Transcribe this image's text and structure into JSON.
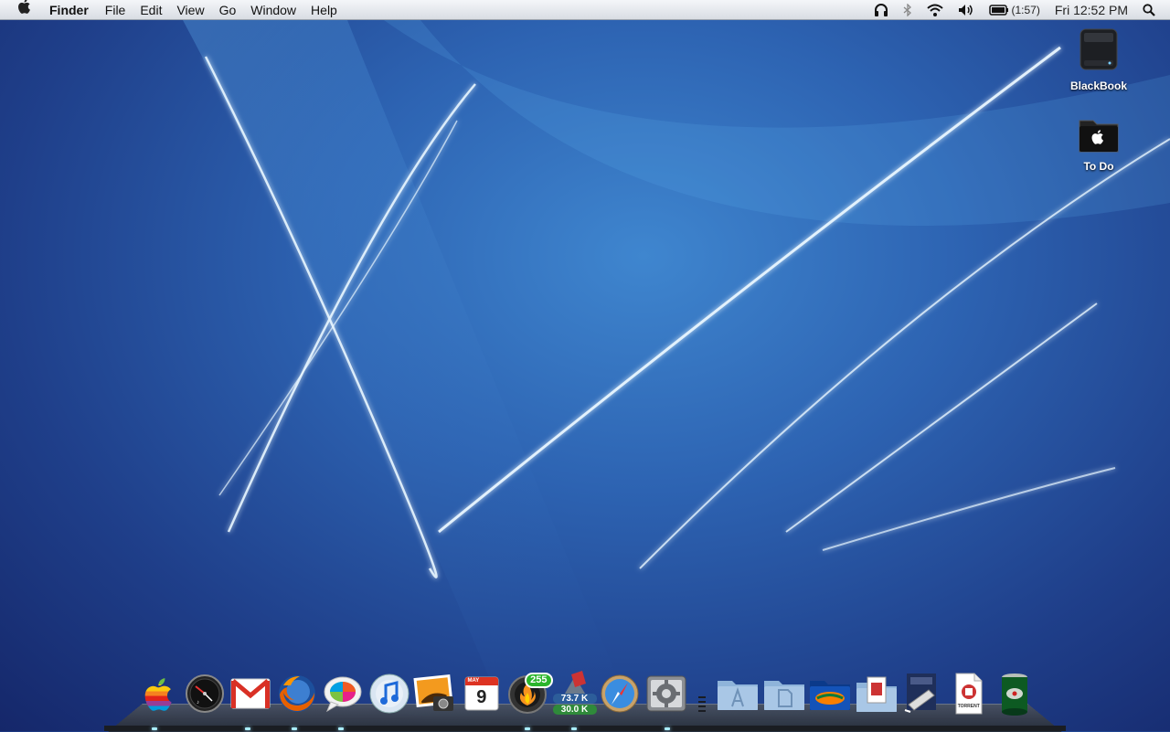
{
  "menubar": {
    "app_name": "Finder",
    "menus": [
      "File",
      "Edit",
      "View",
      "Go",
      "Window",
      "Help"
    ],
    "battery_time": "(1:57)",
    "clock": "Fri 12:52 PM"
  },
  "desktop": {
    "icons": [
      {
        "label": "BlackBook",
        "icon": "hard-drive-icon"
      },
      {
        "label": "To Do",
        "icon": "folder-apple-icon"
      }
    ]
  },
  "dock": {
    "apps": [
      {
        "name": "apple-icon",
        "running": false
      },
      {
        "name": "dashboard-icon",
        "running": true
      },
      {
        "name": "gmail-icon",
        "running": false
      },
      {
        "name": "firefox-icon",
        "running": true
      },
      {
        "name": "messages-icon",
        "running": true
      },
      {
        "name": "itunes-icon",
        "running": false
      },
      {
        "name": "iphoto-icon",
        "running": false
      },
      {
        "name": "ical-icon",
        "running": false
      },
      {
        "name": "fire-icon",
        "running": true
      },
      {
        "name": "network-monitor-icon",
        "running": true
      },
      {
        "name": "safari-icon",
        "running": true
      },
      {
        "name": "system-preferences-icon",
        "running": false
      }
    ],
    "calendar_month": "MAY",
    "calendar_day": "9",
    "fire_badge": "255",
    "net_up": "73.7 K",
    "net_down": "30.0 K",
    "torrent_label": "TORRENT",
    "stacks": [
      {
        "name": "applications-folder-icon"
      },
      {
        "name": "documents-folder-icon"
      },
      {
        "name": "gators-folder-icon"
      },
      {
        "name": "downloads-folder-icon"
      },
      {
        "name": "script-editor-icon"
      },
      {
        "name": "torrent-file-icon"
      },
      {
        "name": "trash-can-icon"
      }
    ]
  }
}
